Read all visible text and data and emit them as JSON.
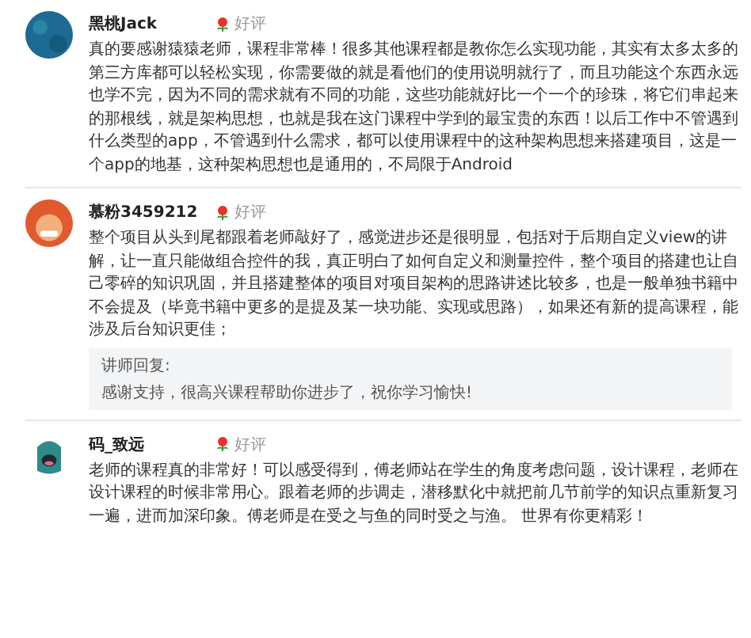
{
  "reviews": [
    {
      "name": "黑桃Jack",
      "badge": "好评",
      "text": "真的要感谢猿猿老师，课程非常棒！很多其他课程都是教你怎么实现功能，其实有太多太多的第三方库都可以轻松实现，你需要做的就是看他们的使用说明就行了，而且功能这个东西永远也学不完，因为不同的需求就有不同的功能，这些功能就好比一个一个的珍珠，将它们串起来的那根线，就是架构思想，也就是我在这门课程中学到的最宝贵的东西！以后工作中不管遇到什么类型的app，不管遇到什么需求，都可以使用课程中的这种架构思想来搭建项目，这是一个app的地基，这种架构思想也是通用的，不局限于Android"
    },
    {
      "name": "慕粉3459212",
      "badge": "好评",
      "text": "整个项目从头到尾都跟着老师敲好了，感觉进步还是很明显，包括对于后期自定义view的讲解，让一直只能做组合控件的我，真正明白了如何自定义和测量控件，整个项目的搭建也让自己零碎的知识巩固，并且搭建整体的项目对项目架构的思路讲述比较多，也是一般单独书籍中不会提及（毕竟书籍中更多的是提及某一块功能、实现或思路），如果还有新的提高课程，能涉及后台知识更佳；",
      "reply": {
        "label": "讲师回复:",
        "text": "感谢支持，很高兴课程帮助你进步了，祝你学习愉快!"
      }
    },
    {
      "name": "码_致远",
      "badge": "好评",
      "text": "老师的课程真的非常好！可以感受得到，傅老师站在学生的角度考虑问题，设计课程，老师在设计课程的时候非常用心。跟着老师的步调走，潜移默化中就把前几节前学的知识点重新复习一遍，进而加深印象。傅老师是在受之与鱼的同时受之与渔。 世界有你更精彩！"
    }
  ]
}
